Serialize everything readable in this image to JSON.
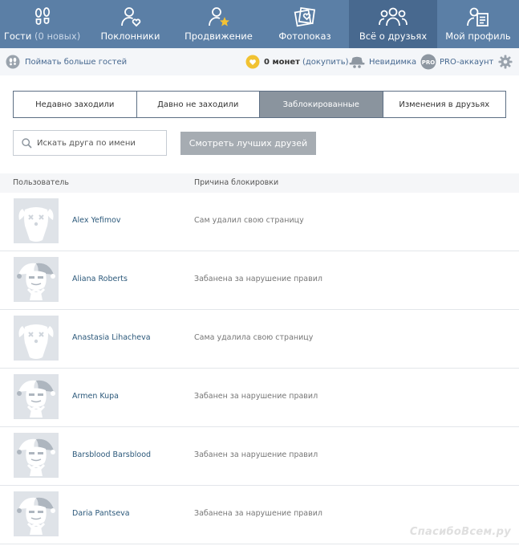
{
  "nav": {
    "tabs": [
      {
        "label": "Гости",
        "extra": "(0 новых)",
        "icon": "footprints-icon",
        "active": false
      },
      {
        "label": "Поклонники",
        "extra": "",
        "icon": "person-heart-icon",
        "active": false
      },
      {
        "label": "Продвижение",
        "extra": "",
        "icon": "person-star-icon",
        "active": false
      },
      {
        "label": "Фотопоказ",
        "extra": "",
        "icon": "photos-heart-icon",
        "active": false
      },
      {
        "label": "Всё о друзьях",
        "extra": "",
        "icon": "friends-group-icon",
        "active": true
      },
      {
        "label": "Мой профиль",
        "extra": "",
        "icon": "profile-card-icon",
        "active": false
      }
    ]
  },
  "subbar": {
    "catch_guests": "Поймать больше гостей",
    "coins_count": "0 монет",
    "coins_buy": "(докупить)",
    "invisible": "Невидимка",
    "pro_badge": "PRO",
    "pro_account": "PRO-аккаунт"
  },
  "segments": [
    "Недавно заходили",
    "Давно не заходили",
    "Заблокированные",
    "Изменения в друзьях"
  ],
  "search": {
    "placeholder": "Искать друга по имени"
  },
  "best_friends_button": "Смотреть лучших друзей",
  "table": {
    "headers": {
      "user": "Пользователь",
      "reason": "Причина блокировки"
    },
    "rows": [
      {
        "name": "Alex Yefimov",
        "reason": "Сам удалил свою страницу",
        "avatar": "deleted-dog-icon"
      },
      {
        "name": "Aliana Roberts",
        "reason": "Забанена за нарушение правил",
        "avatar": "banned-jester-icon"
      },
      {
        "name": "Anastasia Lihacheva",
        "reason": "Сама удалила свою страницу",
        "avatar": "deleted-dog-icon"
      },
      {
        "name": "Armen Kupa",
        "reason": "Забанен за нарушение правил",
        "avatar": "banned-jester-icon"
      },
      {
        "name": "Barsblood Barsblood",
        "reason": "Забанен за нарушение правил",
        "avatar": "banned-jester-icon"
      },
      {
        "name": "Daria Pantseva",
        "reason": "Забанена за нарушение правил",
        "avatar": "banned-jester-icon"
      }
    ]
  },
  "watermark": "СпасибоВсем.ру",
  "colors": {
    "nav_bg": "#5b7fa6",
    "nav_active": "#48698f",
    "segment_active": "#8a949e",
    "link": "#2b587a"
  }
}
